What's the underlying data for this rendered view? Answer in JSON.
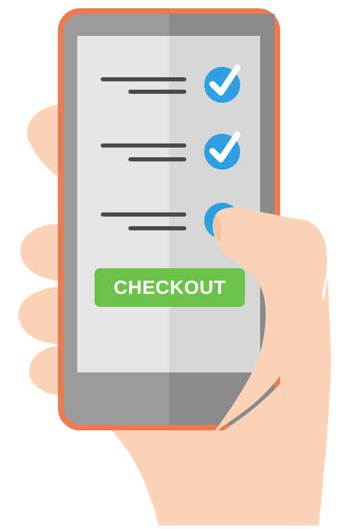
{
  "screen": {
    "checkout_button_label": "CHECKOUT",
    "checklist": [
      {
        "checked": true
      },
      {
        "checked": true
      },
      {
        "checked": false
      }
    ]
  },
  "colors": {
    "phone_frame": "#f07a4f",
    "phone_body_dark": "#8a8a8c",
    "phone_body_light": "#9b9b9d",
    "screen_left": "#e5e5e6",
    "screen_right": "#d7d7d8",
    "text_line": "#4a4a4a",
    "check_circle": "#2e9fe0",
    "checkout_green": "#6cc24a",
    "skin": "#fdd3b7",
    "skin_shadow": "#f5c2a2"
  },
  "icons": {
    "check": "checkmark-circle-icon",
    "hand": "hand-illustration"
  }
}
